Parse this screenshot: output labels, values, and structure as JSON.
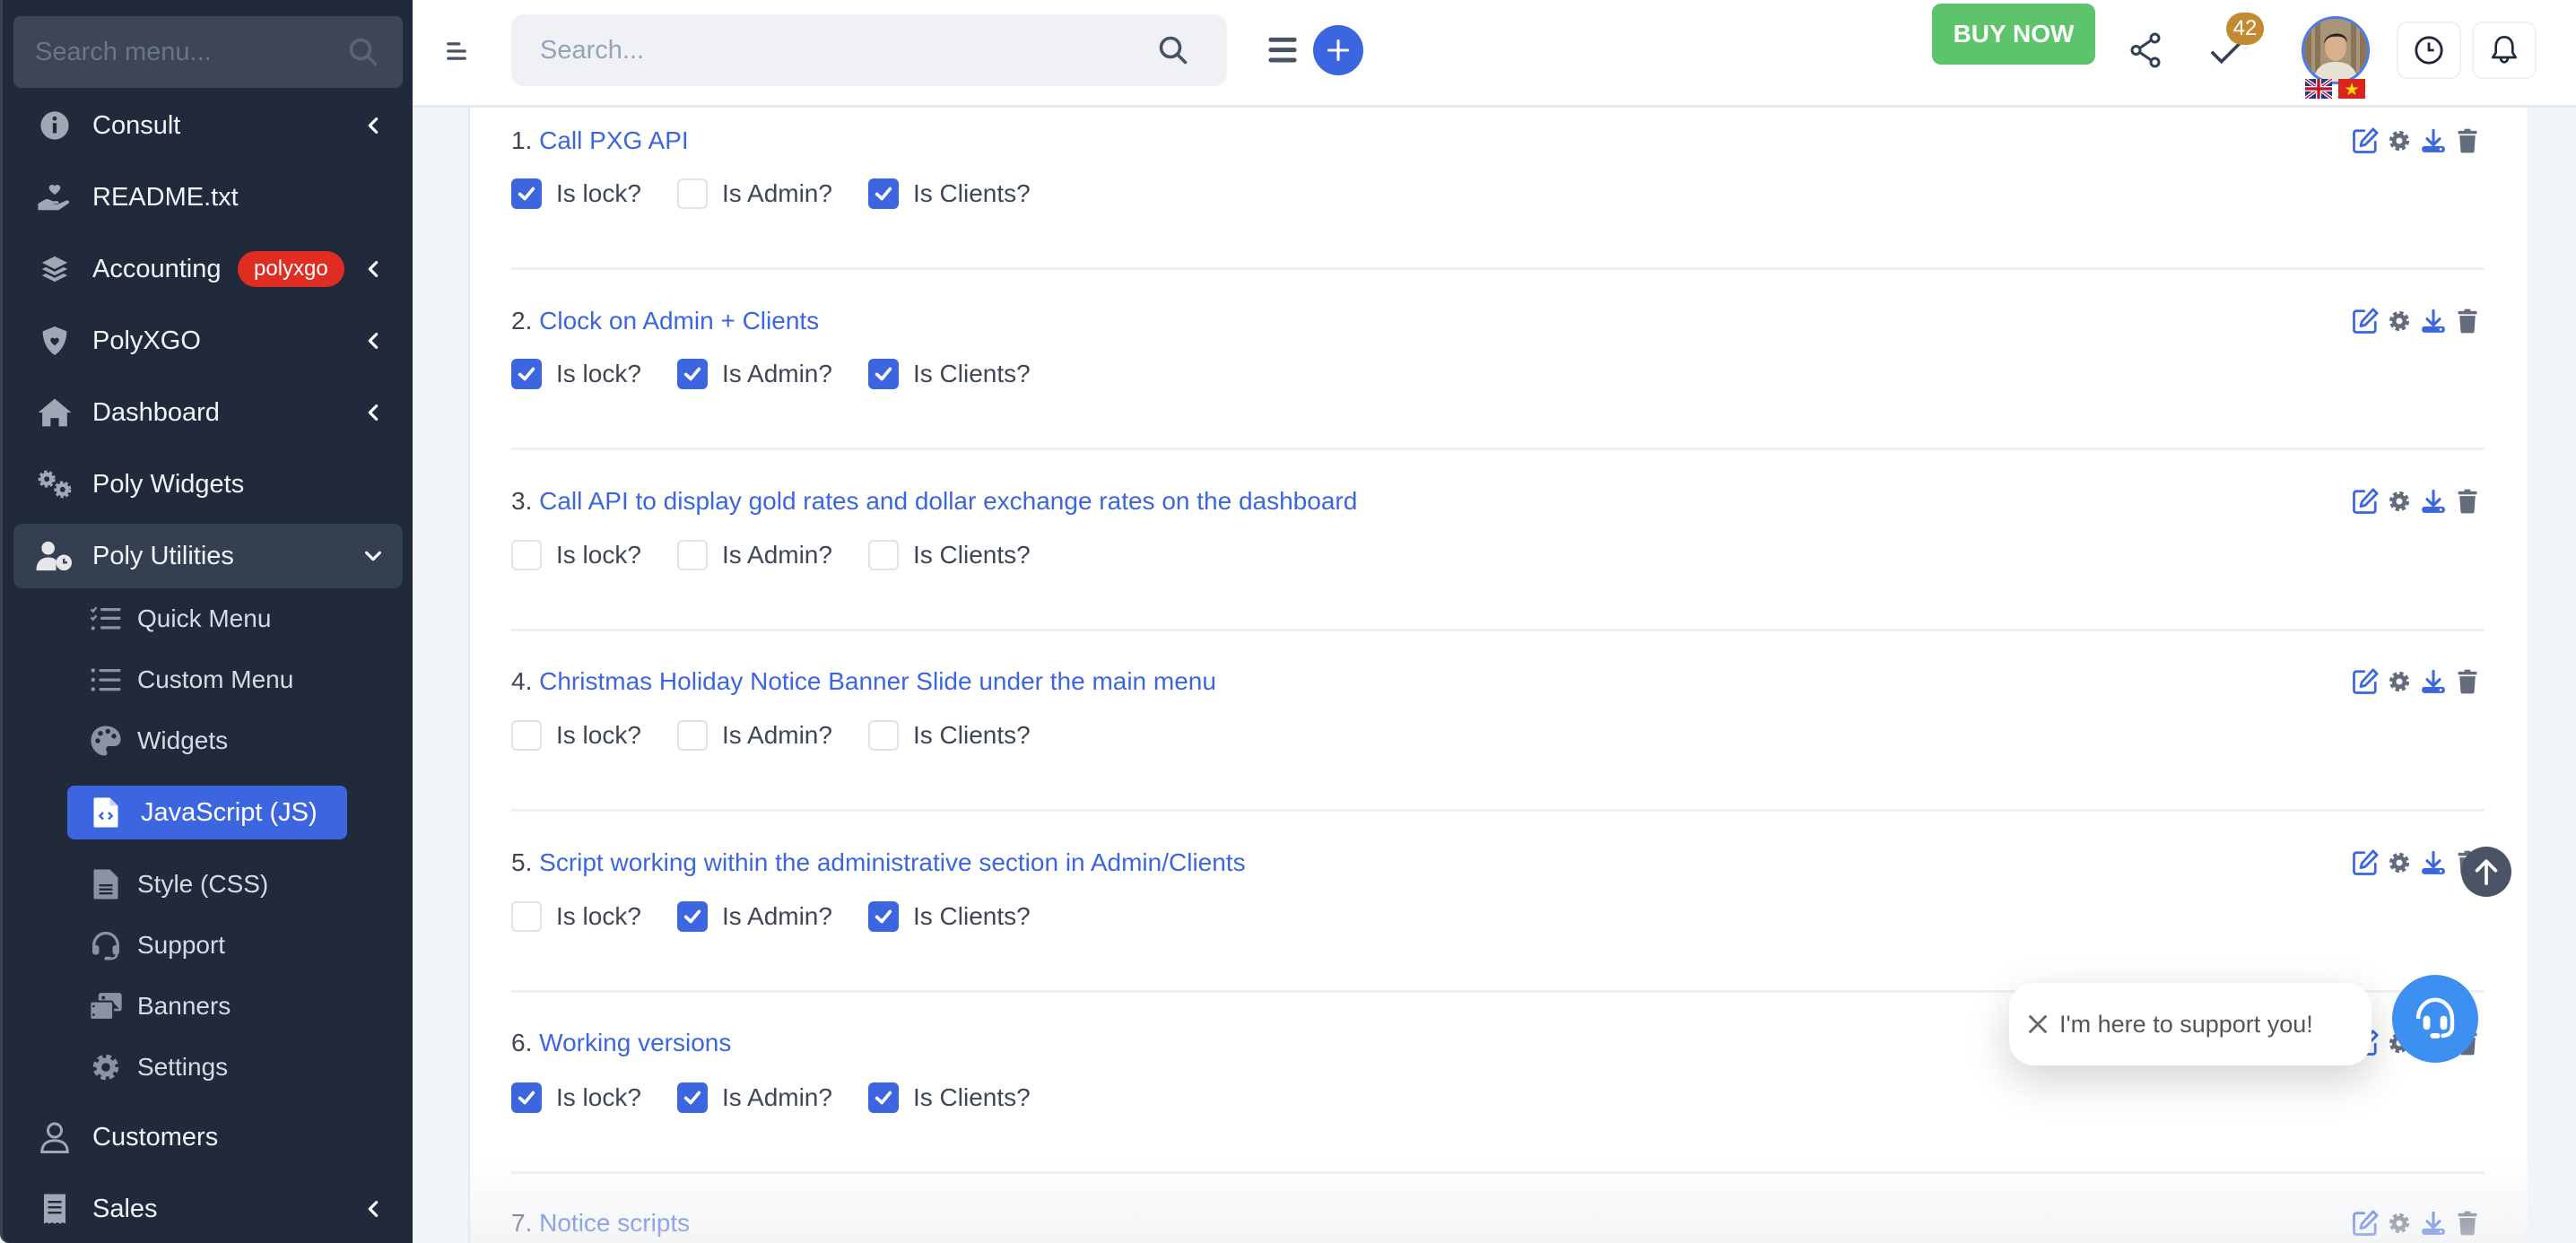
{
  "sidebar": {
    "search_placeholder": "Search menu...",
    "items": [
      {
        "label": "Consult",
        "icon": "info-circle-icon",
        "has_chevron": true
      },
      {
        "label": "README.txt",
        "icon": "hand-heart-icon",
        "has_chevron": false
      },
      {
        "label": "Accounting",
        "icon": "layers-icon",
        "badge": "polyxgo",
        "has_chevron": true
      },
      {
        "label": "PolyXGO",
        "icon": "shield-heart-icon",
        "has_chevron": true
      },
      {
        "label": "Dashboard",
        "icon": "home-icon",
        "has_chevron": true
      },
      {
        "label": "Poly Widgets",
        "icon": "gears-icon",
        "has_chevron": false
      },
      {
        "label": "Poly Utilities",
        "icon": "user-clock-icon",
        "expanded": true
      },
      {
        "label": "Customers",
        "icon": "user-icon",
        "has_chevron": false
      },
      {
        "label": "Sales",
        "icon": "receipt-icon",
        "has_chevron": true
      }
    ],
    "sub_items": [
      {
        "label": "Quick Menu",
        "icon": "list-check-icon"
      },
      {
        "label": "Custom Menu",
        "icon": "list-icon"
      },
      {
        "label": "Widgets",
        "icon": "palette-icon"
      },
      {
        "label": "JavaScript (JS)",
        "icon": "file-code-icon",
        "active": true
      },
      {
        "label": "Style (CSS)",
        "icon": "file-lines-icon"
      },
      {
        "label": "Support",
        "icon": "headset-icon"
      },
      {
        "label": "Banners",
        "icon": "images-icon"
      },
      {
        "label": "Settings",
        "icon": "gear-icon"
      }
    ]
  },
  "header": {
    "search_placeholder": "Search...",
    "buy_now_label": "BUY NOW",
    "tasks_count": "42",
    "colors": {
      "accent": "#3b66e0",
      "buy_now": "#5ec46b",
      "badge": "#c48a30"
    }
  },
  "scripts": {
    "checkbox_labels": {
      "lock": "Is lock?",
      "admin": "Is Admin?",
      "clients": "Is Clients?"
    },
    "rows": [
      {
        "num": "1.",
        "title": "Call PXG API",
        "lock": true,
        "admin": false,
        "clients": true
      },
      {
        "num": "2.",
        "title": "Clock on Admin + Clients",
        "lock": true,
        "admin": true,
        "clients": true
      },
      {
        "num": "3.",
        "title": "Call API to display gold rates and dollar exchange rates on the dashboard",
        "lock": false,
        "admin": false,
        "clients": false
      },
      {
        "num": "4.",
        "title": "Christmas Holiday Notice Banner Slide under the main menu",
        "lock": false,
        "admin": false,
        "clients": false
      },
      {
        "num": "5.",
        "title": "Script working within the administrative section in Admin/Clients",
        "lock": false,
        "admin": true,
        "clients": true
      },
      {
        "num": "6.",
        "title": "Working versions",
        "lock": true,
        "admin": true,
        "clients": true
      },
      {
        "num": "7.",
        "title": "Notice scripts"
      }
    ]
  },
  "support": {
    "message": "I'm here to support you!"
  }
}
